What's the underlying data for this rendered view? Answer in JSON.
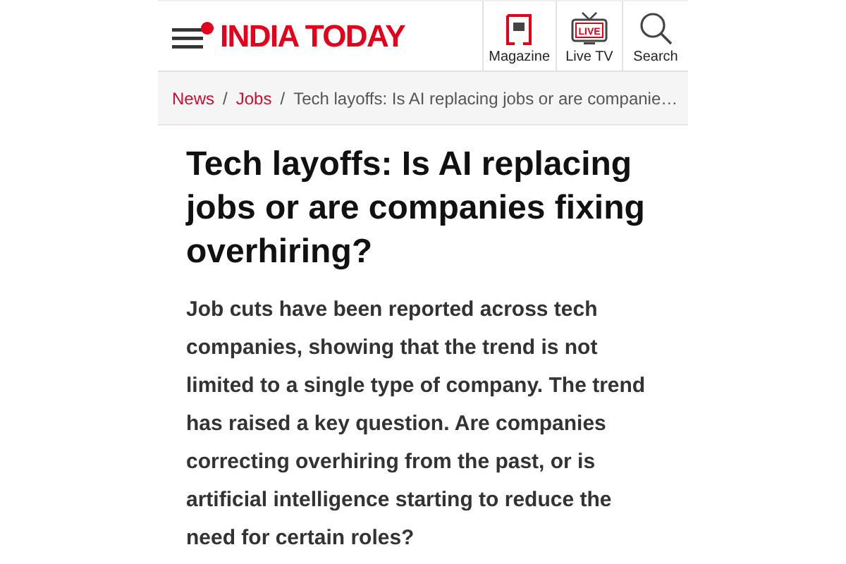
{
  "header": {
    "logo": "INDIA TODAY",
    "nav": [
      {
        "kind": "magazine",
        "label": "Magazine"
      },
      {
        "kind": "livetv",
        "label": "Live TV",
        "badge": "LIVE"
      },
      {
        "kind": "search",
        "label": "Search"
      }
    ]
  },
  "breadcrumb": [
    {
      "label": "News",
      "kind": "link"
    },
    {
      "separator": "/",
      "label": "Jobs",
      "kind": "link"
    },
    {
      "separator": "/",
      "label": "Tech layoffs: Is AI replacing jobs or are companie…",
      "kind": "current"
    }
  ],
  "article": {
    "title": "Tech layoffs: Is AI replacing jobs or are companies fixing overhiring?",
    "summary": "Job cuts have been reported across tech companies, showing that the trend is not limited to a single type of company. The trend has raised a key question. Are companies correcting overhiring from the past, or is artificial intelligence starting to reduce the need for certain roles?"
  }
}
